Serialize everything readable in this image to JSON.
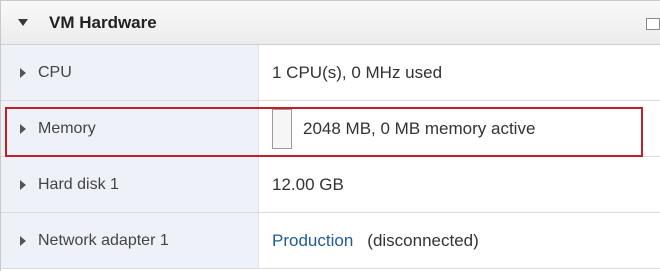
{
  "section": {
    "title": "VM Hardware"
  },
  "rows": [
    {
      "name": "CPU",
      "value": "1 CPU(s), 0 MHz used"
    },
    {
      "name": "Memory",
      "value": "2048 MB, 0 MB memory active"
    },
    {
      "name": "Hard disk 1",
      "value": "12.00 GB"
    },
    {
      "name": "Network adapter 1",
      "link": "Production",
      "suffix": "(disconnected)"
    }
  ],
  "colors": {
    "highlight": "#c0202a",
    "link": "#1f5c96",
    "name_cell_bg": "#eef2f8"
  },
  "icons": {
    "expand_section": "caret-down-icon",
    "expand_row": "caret-right-icon",
    "panel_toggle": "square-icon"
  }
}
